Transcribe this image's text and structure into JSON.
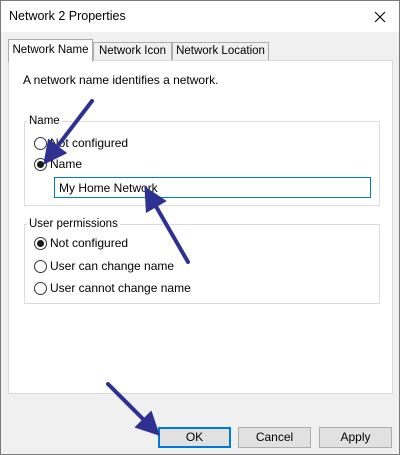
{
  "window": {
    "title": "Network 2 Properties"
  },
  "tabs": [
    {
      "label": "Network Name",
      "active": true
    },
    {
      "label": "Network Icon",
      "active": false
    },
    {
      "label": "Network Location",
      "active": false
    }
  ],
  "panel": {
    "description": "A network name identifies a network.",
    "name_group": {
      "label": "Name",
      "options": [
        {
          "label": "Not configured",
          "checked": false
        },
        {
          "label": "Name",
          "checked": true
        }
      ],
      "name_input_value": "My Home Network"
    },
    "permissions_group": {
      "label": "User permissions",
      "options": [
        {
          "label": "Not configured",
          "checked": true
        },
        {
          "label": "User can change name",
          "checked": false
        },
        {
          "label": "User cannot change name",
          "checked": false
        }
      ]
    }
  },
  "buttons": {
    "ok": "OK",
    "cancel": "Cancel",
    "apply": "Apply"
  },
  "colors": {
    "focus_border": "#0078d7",
    "annotation_arrow": "#2e3192"
  },
  "icons": {
    "close": "close-icon",
    "annotation": "arrow-icon"
  }
}
